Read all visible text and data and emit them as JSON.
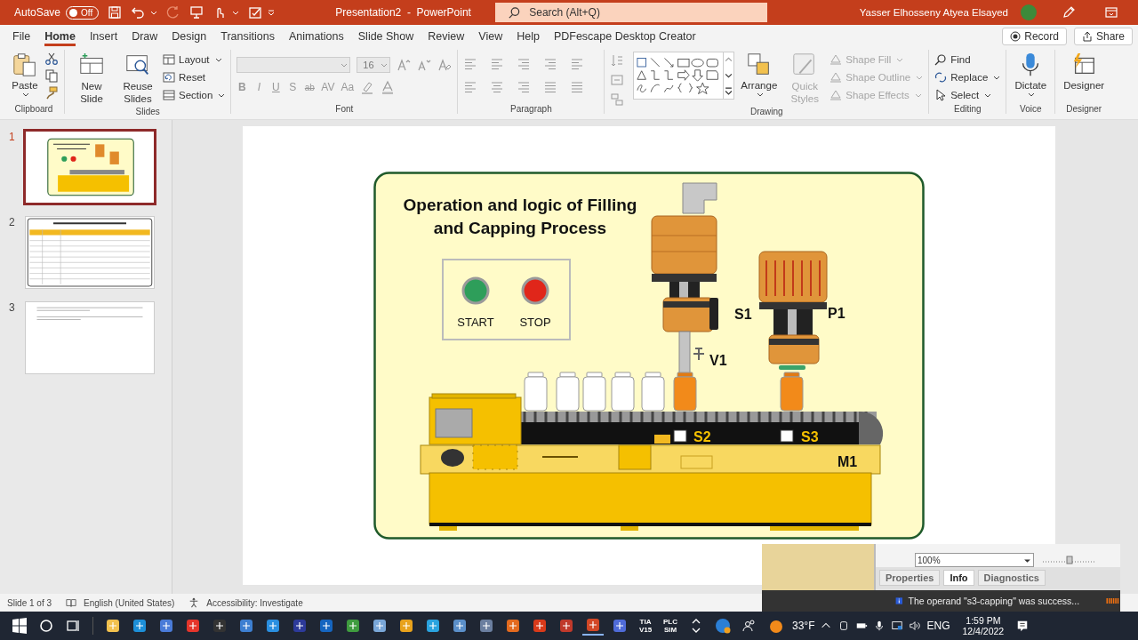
{
  "title_bar": {
    "autosave_label": "AutoSave",
    "autosave_state": "Off",
    "autosave_on": false,
    "title": "Presentation2  -  PowerPoint",
    "search_placeholder": "Search (Alt+Q)",
    "user": "Yasser Elhosseny Atyea Elsayed"
  },
  "tabs": [
    {
      "label": "File",
      "selected": false
    },
    {
      "label": "Home",
      "selected": true
    },
    {
      "label": "Insert",
      "selected": false
    },
    {
      "label": "Draw",
      "selected": false
    },
    {
      "label": "Design",
      "selected": false
    },
    {
      "label": "Transitions",
      "selected": false
    },
    {
      "label": "Animations",
      "selected": false
    },
    {
      "label": "Slide Show",
      "selected": false
    },
    {
      "label": "Review",
      "selected": false
    },
    {
      "label": "View",
      "selected": false
    },
    {
      "label": "Help",
      "selected": false
    },
    {
      "label": "PDFescape Desktop Creator",
      "selected": false
    }
  ],
  "header_buttons": {
    "record": "Record",
    "share": "Share"
  },
  "ribbon": {
    "clipboard": {
      "group": "Clipboard",
      "paste": "Paste"
    },
    "slides": {
      "group": "Slides",
      "new_slide": "New Slide",
      "reuse_slides": "Reuse Slides",
      "layout": "Layout",
      "reset": "Reset",
      "section": "Section"
    },
    "font": {
      "group": "Font",
      "size": "16",
      "disabled": true,
      "buttons": [
        "B",
        "I",
        "U",
        "S",
        "ab",
        "AV",
        "Aa"
      ]
    },
    "paragraph": {
      "group": "Paragraph"
    },
    "drawing": {
      "group": "Drawing",
      "arrange": "Arrange",
      "quick_styles": {
        "label": "Quick Styles",
        "disabled": true
      },
      "shape_options": [
        {
          "label": "Shape Fill",
          "disabled": true
        },
        {
          "label": "Shape Outline",
          "disabled": true
        },
        {
          "label": "Shape Effects",
          "disabled": true
        }
      ]
    },
    "editing": {
      "group": "Editing",
      "find": "Find",
      "replace": "Replace",
      "select": "Select"
    },
    "voice": {
      "group": "Voice",
      "dictate": "Dictate"
    },
    "designer": {
      "group": "Designer",
      "designer": "Designer"
    }
  },
  "slides": [
    {
      "number": "1",
      "selected": true,
      "kind": "diagram"
    },
    {
      "number": "2",
      "selected": false,
      "kind": "table"
    },
    {
      "number": "3",
      "selected": false,
      "kind": "text"
    }
  ],
  "slide": {
    "title_lines": [
      "Operation and logic of Filling",
      "and Capping Process"
    ],
    "buttons": [
      {
        "label": "START",
        "color": "#2e9e5a"
      },
      {
        "label": "STOP",
        "color": "#e0261a"
      }
    ],
    "tags": {
      "s1": "S1",
      "v1": "V1",
      "p1": "P1",
      "s2": "S2",
      "s3": "S3",
      "m1": "M1"
    },
    "bottles": [
      {
        "filled": false
      },
      {
        "filled": false
      },
      {
        "filled": false
      },
      {
        "filled": false
      },
      {
        "filled": false
      },
      {
        "filled": true
      },
      {
        "filled": true
      }
    ]
  },
  "status_bar": {
    "slide_count": "Slide 1 of 3",
    "language": "English (United States)",
    "accessibility": "Accessibility: Investigate"
  },
  "overlay": {
    "zoom": "100%",
    "zoom_slider": {
      "level": 0.5
    },
    "tabs": [
      {
        "label": "Properties",
        "selected": false
      },
      {
        "label": "Info",
        "selected": true
      },
      {
        "label": "Diagnostics",
        "selected": false
      }
    ],
    "message": "The operand \"s3-capping\" was success..."
  },
  "taskbar": {
    "app_labels": [
      "TIA V15",
      "PLC SIM"
    ],
    "weather": "33°F",
    "language": "ENG",
    "time": "1:59 PM",
    "date": "12/4/2022"
  }
}
